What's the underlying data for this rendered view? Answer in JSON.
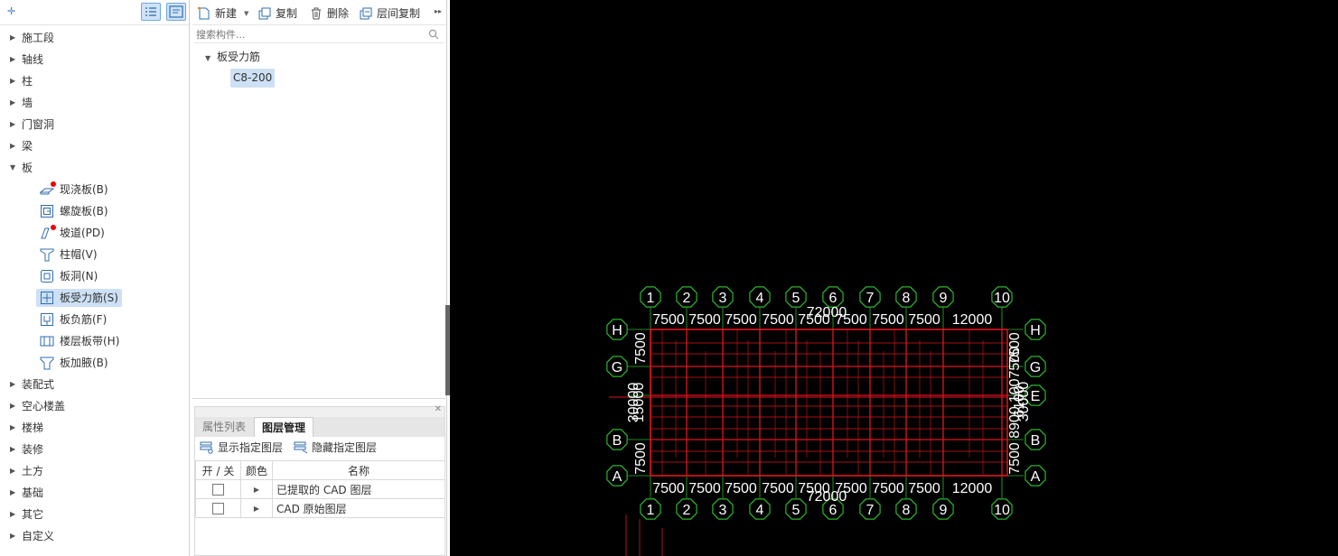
{
  "left_panel": {
    "categories": [
      {
        "label": "施工段",
        "expanded": false
      },
      {
        "label": "轴线",
        "expanded": false
      },
      {
        "label": "柱",
        "expanded": false
      },
      {
        "label": "墙",
        "expanded": false
      },
      {
        "label": "门窗洞",
        "expanded": false
      },
      {
        "label": "梁",
        "expanded": false
      },
      {
        "label": "板",
        "expanded": true
      }
    ],
    "board_children": [
      {
        "label": "现浇板(B)",
        "icon": "cast-slab-icon",
        "red_dot": true
      },
      {
        "label": "螺旋板(B)",
        "icon": "spiral-slab-icon",
        "red_dot": false
      },
      {
        "label": "坡道(PD)",
        "icon": "ramp-icon",
        "red_dot": true
      },
      {
        "label": "柱帽(V)",
        "icon": "column-cap-icon",
        "red_dot": false
      },
      {
        "label": "板洞(N)",
        "icon": "slab-hole-icon",
        "red_dot": false
      },
      {
        "label": "板受力筋(S)",
        "icon": "slab-main-rebar-icon",
        "red_dot": false,
        "selected": true
      },
      {
        "label": "板负筋(F)",
        "icon": "slab-negative-rebar-icon",
        "red_dot": false
      },
      {
        "label": "楼层板带(H)",
        "icon": "floor-slab-strip-icon",
        "red_dot": false
      },
      {
        "label": "板加腋(B)",
        "icon": "slab-haunch-icon",
        "red_dot": false
      }
    ],
    "more_categories": [
      {
        "label": "装配式"
      },
      {
        "label": "空心楼盖"
      },
      {
        "label": "楼梯"
      },
      {
        "label": "装修"
      },
      {
        "label": "土方"
      },
      {
        "label": "基础"
      },
      {
        "label": "其它"
      },
      {
        "label": "自定义"
      }
    ]
  },
  "mid_panel": {
    "toolbar": {
      "new_label": "新建",
      "copy_label": "复制",
      "delete_label": "删除",
      "floor_copy_label": "层间复制"
    },
    "search": {
      "placeholder": "搜索构件..."
    },
    "component_tree": {
      "group_label": "板受力筋",
      "items": [
        {
          "label": "C8-200",
          "selected": true
        }
      ]
    },
    "props": {
      "tabs": [
        {
          "label": "属性列表",
          "active": false
        },
        {
          "label": "图层管理",
          "active": true
        }
      ],
      "show_layers_label": "显示指定图层",
      "hide_layers_label": "隐藏指定图层",
      "columns": [
        "开 / 关",
        "颜色",
        "名称"
      ],
      "rows": [
        {
          "name": "已提取的 CAD 图层",
          "checked": false
        },
        {
          "name": "CAD 原始图层",
          "checked": false
        }
      ]
    }
  },
  "cad": {
    "top_axes": [
      "1",
      "2",
      "3",
      "4",
      "5",
      "6",
      "7",
      "8",
      "9",
      "10"
    ],
    "side_axes": [
      "H",
      "G",
      "E",
      "B",
      "A"
    ],
    "top_total": "72000",
    "bottom_total": "72000",
    "span_labels": [
      "7500",
      "7500",
      "7500",
      "7500",
      "7500",
      "7500",
      "7500",
      "7500",
      "12000"
    ],
    "left_labels": [
      "7500",
      "30000",
      "15000",
      "7500"
    ],
    "right_labels": [
      "7500",
      "1007500",
      "6100",
      "30000",
      "8900",
      "7500"
    ],
    "colors": {
      "background": "#000000",
      "axis_circle": "#2bb52b",
      "axis_text": "#ffffff",
      "beam_lines": "#e0141e"
    }
  }
}
